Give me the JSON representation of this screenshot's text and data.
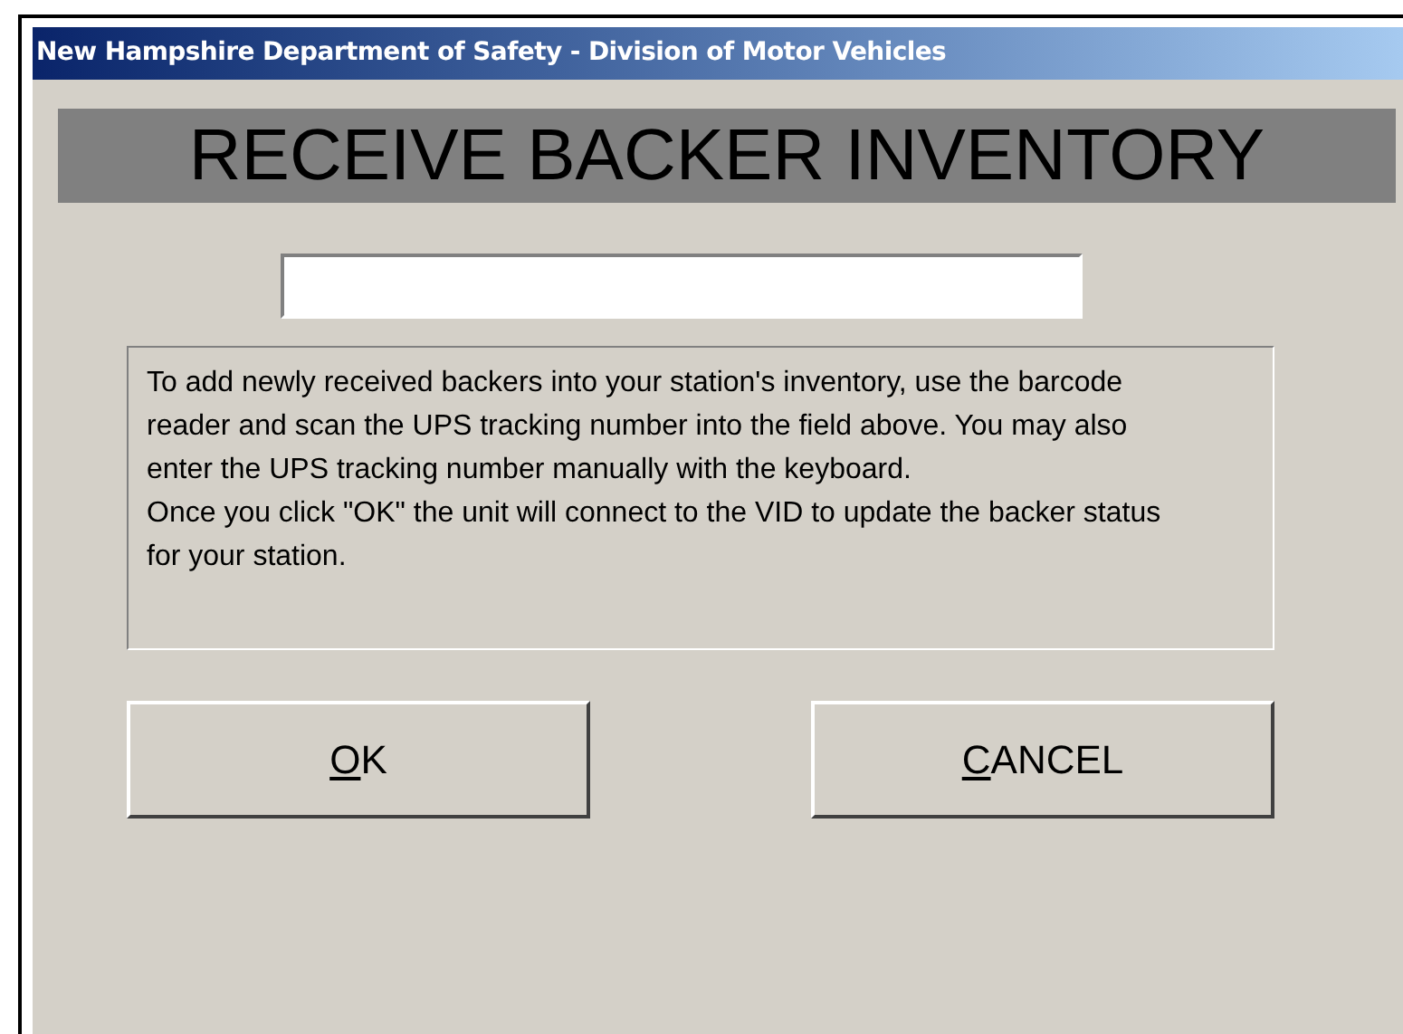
{
  "window": {
    "title": "New Hampshire Department of Safety - Division of Motor Vehicles"
  },
  "heading": "RECEIVE BACKER INVENTORY",
  "instructions": [
    "To add newly received backers into your station's inventory, use the barcode reader and scan the UPS tracking number into the field above. You may also enter the UPS tracking number manually with the keyboard.",
    "Once you click \"OK\" the unit will connect to the VID to update the backer status for your station."
  ],
  "buttons": [
    {
      "label": "OK"
    },
    {
      "label": "CANCEL"
    }
  ]
}
